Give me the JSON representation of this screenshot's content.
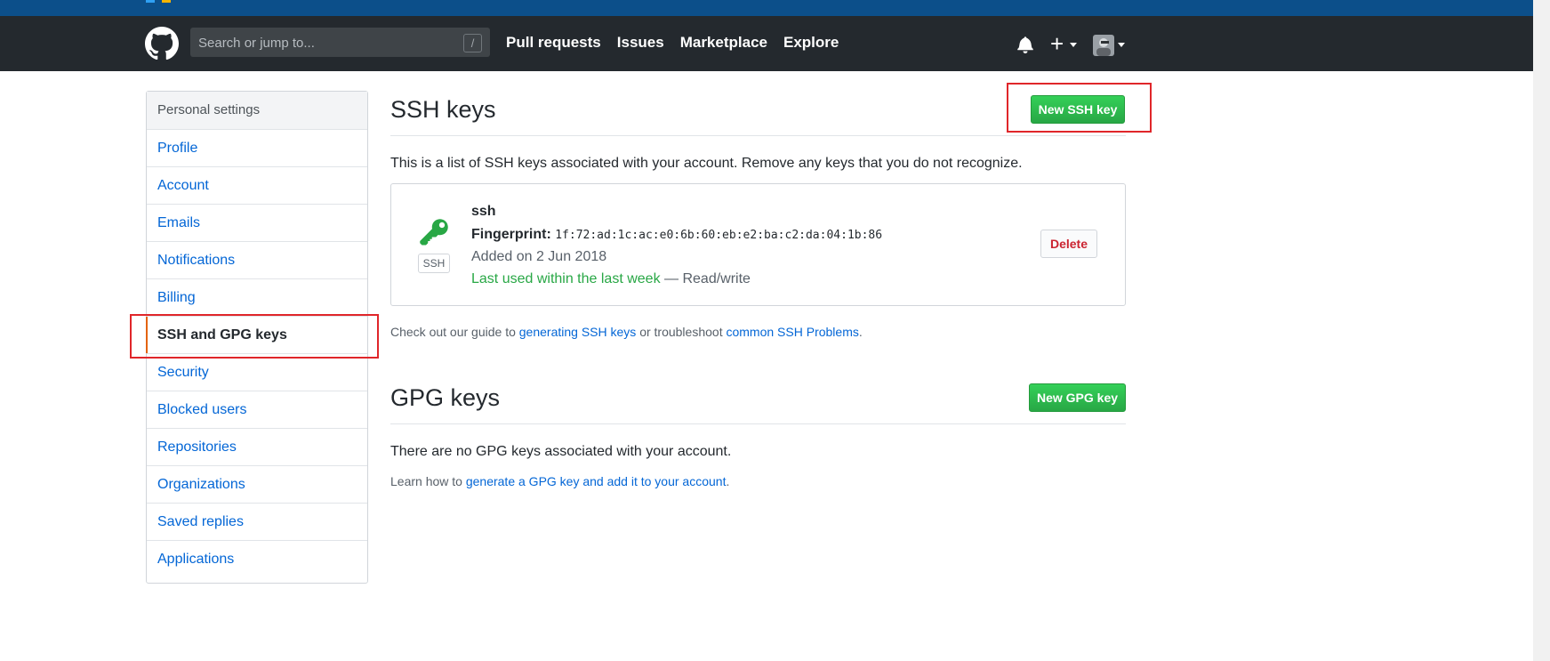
{
  "header": {
    "search_placeholder": "Search or jump to...",
    "search_shortcut": "/",
    "nav": [
      "Pull requests",
      "Issues",
      "Marketplace",
      "Explore"
    ],
    "plus_label": "+"
  },
  "sidebar": {
    "heading": "Personal settings",
    "items": [
      {
        "label": "Profile"
      },
      {
        "label": "Account"
      },
      {
        "label": "Emails"
      },
      {
        "label": "Notifications"
      },
      {
        "label": "Billing"
      },
      {
        "label": "SSH and GPG keys"
      },
      {
        "label": "Security"
      },
      {
        "label": "Blocked users"
      },
      {
        "label": "Repositories"
      },
      {
        "label": "Organizations"
      },
      {
        "label": "Saved replies"
      },
      {
        "label": "Applications"
      }
    ],
    "selected": "SSH and GPG keys"
  },
  "ssh": {
    "title": "SSH keys",
    "new_button": "New SSH key",
    "description": "This is a list of SSH keys associated with your account. Remove any keys that you do not recognize.",
    "key": {
      "badge": "SSH",
      "name": "ssh",
      "fingerprint_label": "Fingerprint:",
      "fingerprint": "1f:72:ad:1c:ac:e0:6b:60:eb:e2:ba:c2:da:04:1b:86",
      "added": "Added on 2 Jun 2018",
      "last_used": "Last used within the last week",
      "access": "— Read/write",
      "delete": "Delete"
    },
    "guide": {
      "prefix": "Check out our guide to",
      "link1": "generating SSH keys",
      "middle": "or troubleshoot",
      "link2": "common SSH Problems",
      "suffix": "."
    }
  },
  "gpg": {
    "title": "GPG keys",
    "new_button": "New GPG key",
    "empty": "There are no GPG keys associated with your account.",
    "learn_prefix": "Learn how to",
    "learn_link": "generate a GPG key and add it to your account",
    "learn_suffix": "."
  },
  "colors": {
    "header_bg": "#24292e",
    "accent_green": "#28a745",
    "link_blue": "#0366d6",
    "highlight_red": "#e0262a"
  }
}
